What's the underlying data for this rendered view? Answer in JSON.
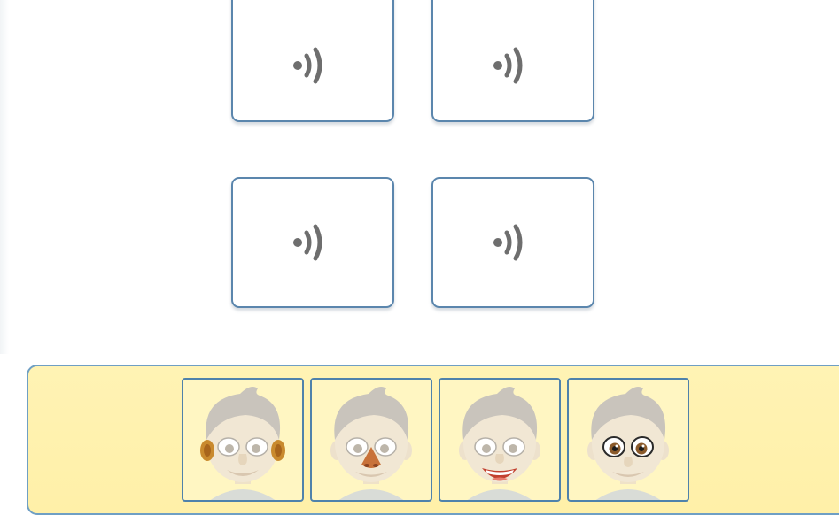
{
  "sound_cards": [
    {
      "icon": "speaker-sound-icon"
    },
    {
      "icon": "speaker-sound-icon"
    },
    {
      "icon": "speaker-sound-icon"
    },
    {
      "icon": "speaker-sound-icon"
    }
  ],
  "face_cards": [
    {
      "icon": "boy-face-ears-icon",
      "highlight": "ears",
      "highlight_color": "#c98a2e"
    },
    {
      "icon": "boy-face-nose-icon",
      "highlight": "nose",
      "highlight_color": "#c8723a"
    },
    {
      "icon": "boy-face-mouth-icon",
      "highlight": "mouth",
      "highlight_color": "#c2402f"
    },
    {
      "icon": "boy-face-eyes-icon",
      "highlight": "eyes",
      "highlight_color": "#8a5a2b"
    }
  ],
  "colors": {
    "card_border": "#5b86ad",
    "speaker_icon": "#6e6e6e",
    "tray_background": "#fff3b4",
    "tray_border": "#6f9fc4"
  }
}
